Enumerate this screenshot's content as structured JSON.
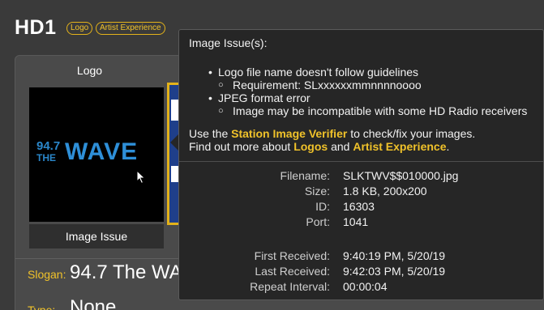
{
  "header": {
    "title": "HD1",
    "tags": [
      "Logo",
      "Artist Experience"
    ]
  },
  "logo_panel": {
    "heading": "Logo",
    "logo_art": {
      "number": "94.7",
      "the": "THE",
      "word": "WAVE"
    },
    "status_label": "Image Issue"
  },
  "fields": {
    "slogan_label": "Slogan:",
    "slogan_value": "94.7 The WA",
    "type_label": "Type:",
    "type_value": "None"
  },
  "tooltip": {
    "title": "Image Issue(s):",
    "issues": [
      {
        "text": "Logo file name doesn't follow guidelines",
        "detail": "Requirement: SLxxxxxxmmnnnnoooo"
      },
      {
        "text": "JPEG format error",
        "detail": "Image may be incompatible with some HD Radio receivers"
      }
    ],
    "use_prefix": "Use the",
    "verifier_link": "Station Image Verifier",
    "use_suffix": "to check/fix your images.",
    "more_prefix": "Find out more about",
    "logos_link": "Logos",
    "and_text": "and",
    "artist_link": "Artist Experience",
    "more_suffix": ".",
    "details": [
      {
        "key": "Filename:",
        "value": "SLKTWV$$010000.jpg"
      },
      {
        "key": "Size:",
        "value": "1.8 KB, 200x200"
      },
      {
        "key": "ID:",
        "value": "16303"
      },
      {
        "key": "Port:",
        "value": "1041"
      },
      {
        "key": "First Received:",
        "value": "9:40:19 PM, 5/20/19"
      },
      {
        "key": "Last Received:",
        "value": "9:42:03 PM, 5/20/19"
      },
      {
        "key": "Repeat Interval:",
        "value": "00:00:04"
      }
    ]
  },
  "colors": {
    "accent": "#f0c22a",
    "background": "#3a3a3a",
    "tooltip_bg": "#262626",
    "logo_blue": "#2e8fd8"
  }
}
